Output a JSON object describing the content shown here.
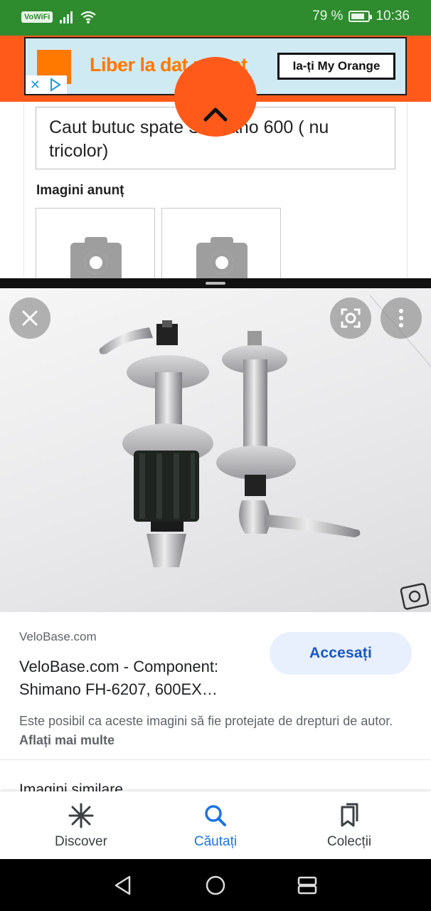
{
  "status_bar": {
    "network_badge": "VoWiFi",
    "battery_percent": "79 %",
    "battery_level": 0.79,
    "time": "10:36"
  },
  "ad": {
    "headline": "Liber la dat pe net",
    "cta": "Ia-ți My Orange",
    "brand_color": "#ff7900"
  },
  "listing": {
    "description": "Caut butuc spate Shimano 600 ( nu tricolor)",
    "images_heading": "Imagini anunț"
  },
  "image_result": {
    "source": "VeloBase.com",
    "title": "VeloBase.com - Component: Shimano FH-6207, 600EX…",
    "visit_label": "Accesați",
    "copyright_text": "Este posibil ca aceste imagini să fie protejate de drepturi de autor.",
    "learn_more": "Aflați mai multe",
    "similar_heading": "Imagini similare"
  },
  "bottom_nav": {
    "items": [
      {
        "label": "Discover",
        "icon": "asterisk-icon",
        "active": false
      },
      {
        "label": "Căutați",
        "icon": "search-icon",
        "active": true
      },
      {
        "label": "Colecții",
        "icon": "collections-icon",
        "active": false
      }
    ]
  },
  "colors": {
    "status_bar": "#2e8b2e",
    "header_orange": "#ff5a1a",
    "accent_blue": "#1a73e8",
    "visit_bg": "#e8f0fe"
  }
}
